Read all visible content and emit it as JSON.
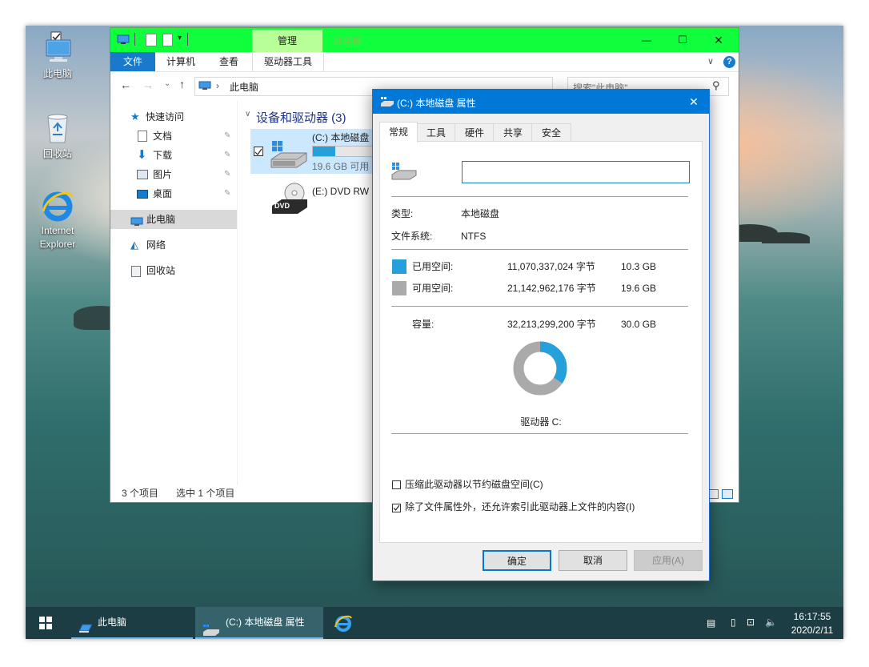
{
  "desktop": {
    "icons": [
      {
        "label": "此电脑"
      },
      {
        "label": "回收站"
      },
      {
        "label": "Internet Explorer",
        "line1": "Internet",
        "line2": "Explorer"
      }
    ]
  },
  "explorer": {
    "context_tab": "管理",
    "context_tab_faded": "此电脑",
    "ribbon_tabs": [
      "文件",
      "计算机",
      "查看",
      "驱动器工具"
    ],
    "address_path": "此电脑",
    "search_placeholder": "搜索\"此电脑\"",
    "nav": {
      "quick_access": "快速访问",
      "pinned": [
        "文档",
        "下载",
        "图片",
        "桌面"
      ],
      "this_pc": "此电脑",
      "network": "网络",
      "recycle_bin": "回收站"
    },
    "group_header": "设备和驱动器 (3)",
    "drives": [
      {
        "name": "(C:) 本地磁盘",
        "free": "19.6 GB 可用",
        "used_fraction": 0.34
      },
      {
        "name": "(E:) DVD RW",
        "badge": "DVD"
      }
    ],
    "status": {
      "count": "3 个项目",
      "selected": "选中 1 个项目"
    }
  },
  "dialog": {
    "title": "(C:) 本地磁盘 属性",
    "tabs": [
      "常规",
      "工具",
      "硬件",
      "共享",
      "安全"
    ],
    "active_tab": "常规",
    "name_value": "",
    "type_label": "类型:",
    "type_value": "本地磁盘",
    "fs_label": "文件系统:",
    "fs_value": "NTFS",
    "used_label": "已用空间:",
    "used_bytes": "11,070,337,024 字节",
    "used_gb": "10.3 GB",
    "free_label": "可用空间:",
    "free_bytes": "21,142,962,176 字节",
    "free_gb": "19.6 GB",
    "capacity_label": "容量:",
    "capacity_bytes": "32,213,299,200 字节",
    "capacity_gb": "30.0 GB",
    "drive_label": "驱动器 C:",
    "used_fraction": 0.344,
    "used_color": "#26a0da",
    "free_color": "#aaaaaa",
    "compress_label": "压缩此驱动器以节约磁盘空间(C)",
    "compress_checked": false,
    "index_label": "除了文件属性外，还允许索引此驱动器上文件的内容(I)",
    "index_checked": true,
    "ok_label": "确定",
    "cancel_label": "取消",
    "apply_label": "应用(A)"
  },
  "taskbar": {
    "items": [
      "此电脑",
      "(C:) 本地磁盘 属性"
    ],
    "time": "16:17:55",
    "date": "2020/2/11"
  }
}
